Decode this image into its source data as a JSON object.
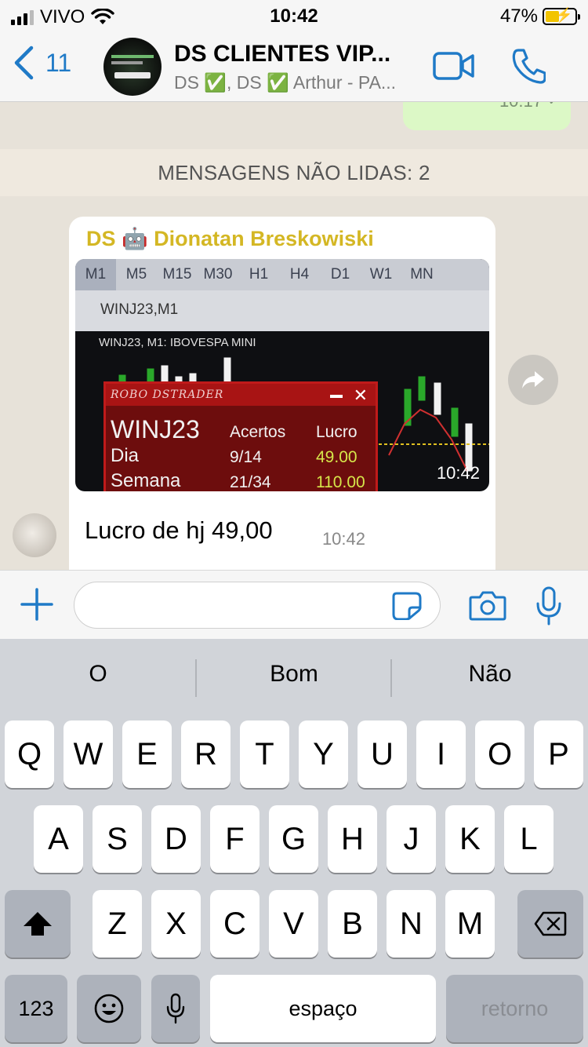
{
  "status_bar": {
    "carrier": "VIVO",
    "time": "10:42",
    "battery": "47%",
    "battery_level": 0.47
  },
  "header": {
    "back_count": "11",
    "title": "DS CLIENTES VIP...",
    "subtitle": "DS ✅, DS ✅ Arthur - PA...",
    "icons": [
      "back-chevron-icon",
      "video-call-icon",
      "phone-icon"
    ]
  },
  "chat": {
    "outgoing_time": "10:17",
    "outgoing_status": "✓",
    "unread_banner": "MENSAGENS NÃO LIDAS: 2",
    "image_message": {
      "sender": "DS 🤖 Dionatan Breskowiski",
      "time": "10:42",
      "photo": {
        "timeframes": [
          "M1",
          "M5",
          "M15",
          "M30",
          "H1",
          "H4",
          "D1",
          "W1",
          "MN"
        ],
        "symbol": "WINJ23,M1",
        "chart_header": "WINJ23, M1:  IBOVESPA MINI",
        "robo_title": "ROBO DSTRADER",
        "symbol_big": "WINJ23",
        "col_acertos": "Acertos",
        "col_lucro": "Lucro",
        "row1_label": "Dia",
        "row1_acertos": "9/14",
        "row1_lucro": "49.00",
        "row2_label": "Semana",
        "row2_acertos": "21/34",
        "row2_lucro": "110.00"
      }
    },
    "text_message": {
      "text": "Lucro de hj 49,00",
      "time": "10:42"
    }
  },
  "input_bar": {
    "message_value": ""
  },
  "keyboard": {
    "suggestions": [
      "O",
      "Bom",
      "Não"
    ],
    "row1": [
      "Q",
      "W",
      "E",
      "R",
      "T",
      "Y",
      "U",
      "I",
      "O",
      "P"
    ],
    "row2": [
      "A",
      "S",
      "D",
      "F",
      "G",
      "H",
      "J",
      "K",
      "L"
    ],
    "row3": [
      "Z",
      "X",
      "C",
      "V",
      "B",
      "N",
      "M"
    ],
    "numbers_key": "123",
    "space_key": "espaço",
    "return_key": "retorno"
  },
  "colors": {
    "accent": "#1f7ac7",
    "outgoing_bubble": "#dcf8c6",
    "sender_name": "#d4b724"
  }
}
